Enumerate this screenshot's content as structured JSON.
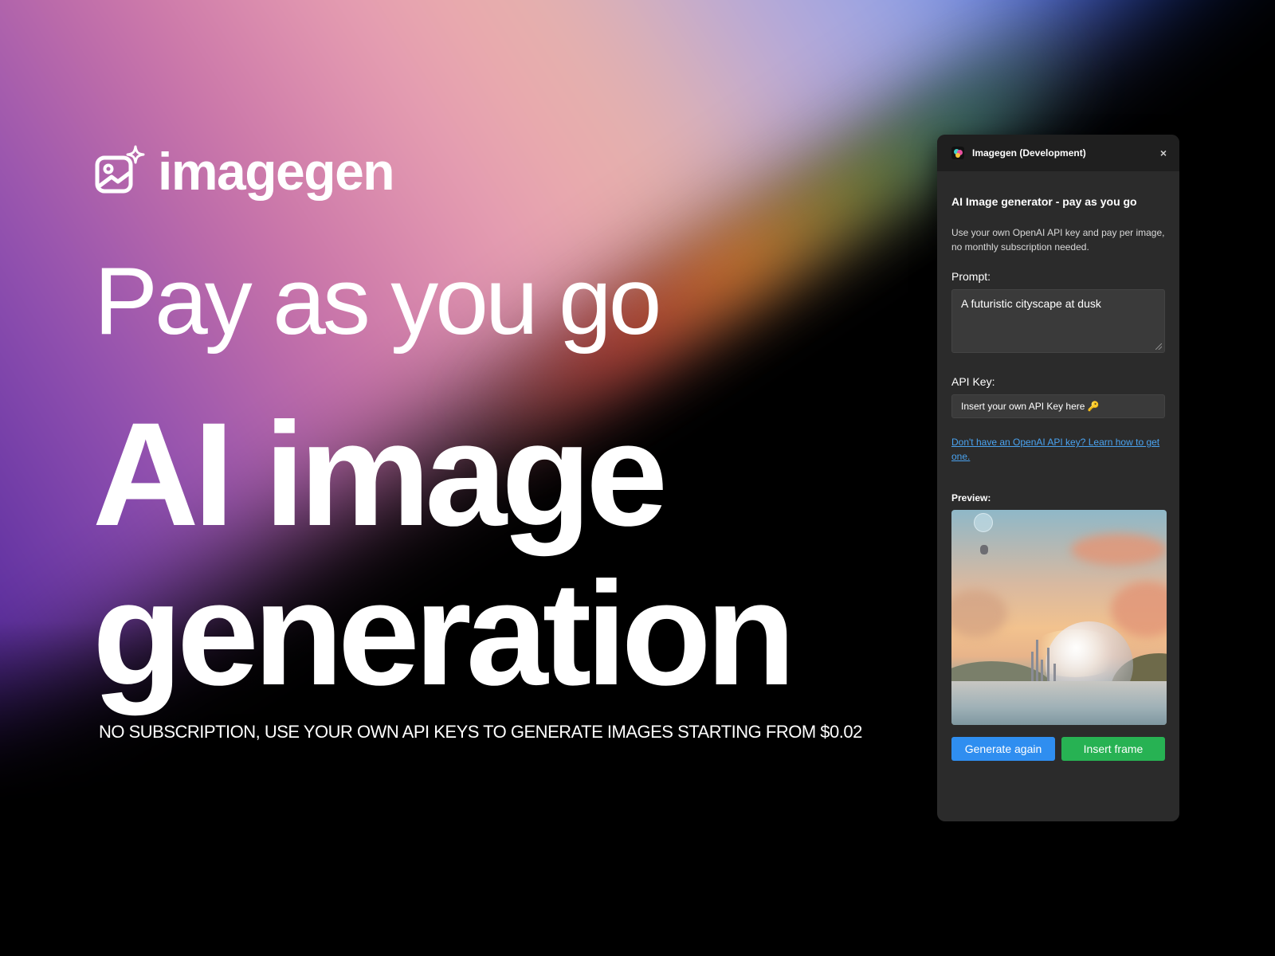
{
  "brand": {
    "name": "imagegen"
  },
  "hero": {
    "line1": "Pay as you go",
    "line2": "AI image",
    "line3": "generation",
    "tagline": "NO SUBSCRIPTION, USE YOUR OWN API KEYS TO GENERATE IMAGES STARTING FROM $0.02"
  },
  "panel": {
    "title": "Imagegen (Development)",
    "close_icon": "×",
    "heading": "AI Image generator - pay as you go",
    "description": "Use your own OpenAI API key and pay per image, no monthly subscription needed.",
    "prompt_label": "Prompt:",
    "prompt_value": "A futuristic cityscape at dusk",
    "api_label": "API Key:",
    "api_value": "Insert your own API Key here 🔑",
    "help_link": "Don't have an OpenAI API key? Learn how to get one.",
    "preview_label": "Preview:",
    "generate_button": "Generate again",
    "insert_button": "Insert frame"
  },
  "colors": {
    "accent_blue": "#2f8ef0",
    "accent_green": "#27b253",
    "link": "#4aa3f0",
    "panel_bg": "#2b2b2b"
  }
}
